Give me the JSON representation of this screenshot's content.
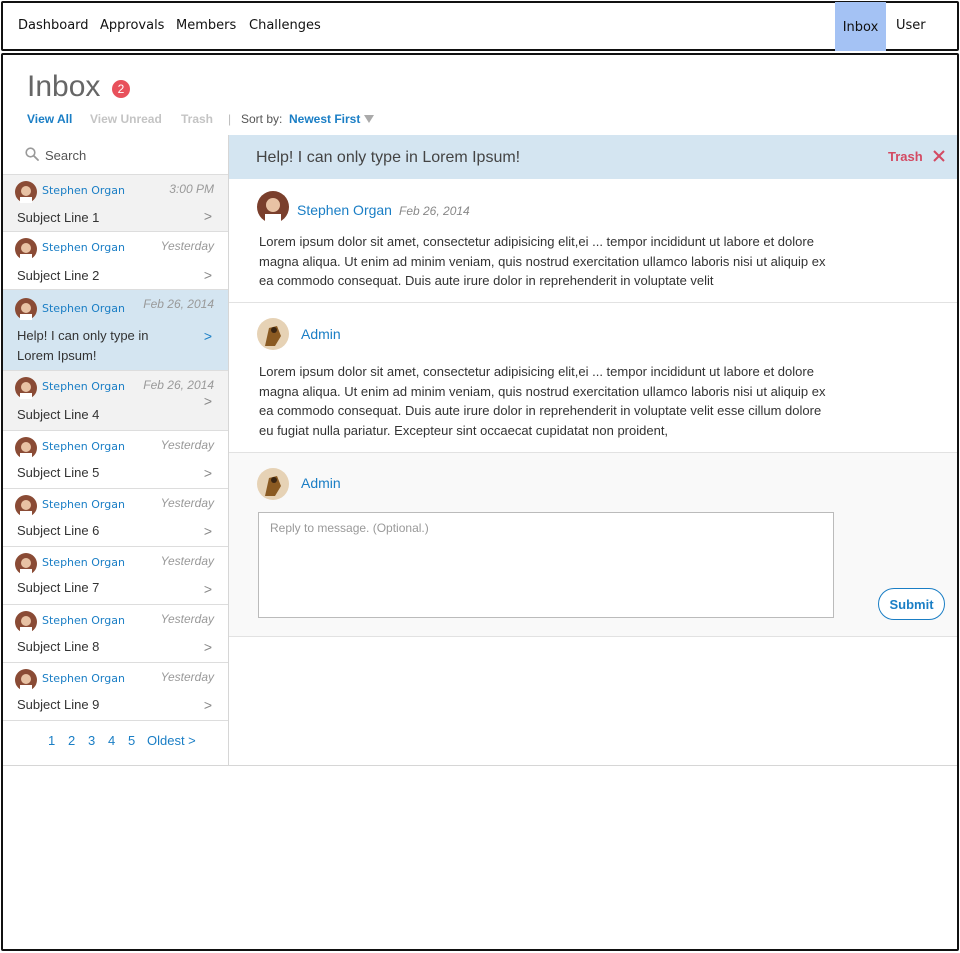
{
  "nav": {
    "items": [
      {
        "label": "Dashboard"
      },
      {
        "label": "Approvals"
      },
      {
        "label": "Members"
      },
      {
        "label": "Challenges"
      }
    ],
    "inbox": "Inbox",
    "user": "User",
    "active_color": "#a4c2f4"
  },
  "inbox": {
    "title": "Inbox",
    "unread_count": "2",
    "filters": {
      "view_all": "View All",
      "view_unread": "View Unread",
      "trash": "Trash",
      "divider": "|",
      "sort_label": "Sort by:",
      "sort_value": "Newest First"
    }
  },
  "search": {
    "placeholder": "Search"
  },
  "messages": [
    {
      "sender": "Stephen Organ",
      "time": "3:00 PM",
      "subject": "Subject Line 1",
      "chevron": ">"
    },
    {
      "sender": "Stephen Organ",
      "time": "Yesterday",
      "subject": "Subject Line 2",
      "chevron": ">"
    },
    {
      "sender": "Stephen Organ",
      "time": "Feb 26, 2014",
      "subject": "Help! I can only type in Lorem Ipsum!",
      "chevron": ">"
    },
    {
      "sender": "Stephen Organ",
      "time": "Feb 26, 2014",
      "subject": "Subject Line 4",
      "chevron": ">"
    },
    {
      "sender": "Stephen Organ",
      "time": "Yesterday",
      "subject": "Subject Line 5",
      "chevron": ">"
    },
    {
      "sender": "Stephen Organ",
      "time": "Yesterday",
      "subject": "Subject Line 6",
      "chevron": ">"
    },
    {
      "sender": "Stephen Organ",
      "time": "Yesterday",
      "subject": "Subject Line 7",
      "chevron": ">"
    },
    {
      "sender": "Stephen Organ",
      "time": "Yesterday",
      "subject": "Subject Line 8",
      "chevron": ">"
    },
    {
      "sender": "Stephen Organ",
      "time": "Yesterday",
      "subject": "Subject Line 9",
      "chevron": ">"
    }
  ],
  "pagination": {
    "pages": [
      "1",
      "2",
      "3",
      "4",
      "5"
    ],
    "oldest": "Oldest >"
  },
  "conversation": {
    "title": "Help! I can only type in Lorem Ipsum!",
    "trash": "Trash",
    "posts": [
      {
        "author": "Stephen Organ",
        "date": "Feb 26, 2014",
        "body": "Lorem ipsum dolor sit amet, consectetur adipisicing elit,ei ... tempor incididunt ut labore et dolore magna aliqua. Ut enim ad minim veniam, quis nostrud exercitation ullamco laboris nisi ut aliquip ex ea commodo consequat. Duis aute irure dolor in reprehenderit in voluptate velit"
      },
      {
        "author": "Admin",
        "body": "Lorem ipsum dolor sit amet, consectetur adipisicing elit,ei ... tempor incididunt ut labore et dolore magna aliqua. Ut enim ad minim veniam, quis nostrud exercitation ullamco laboris nisi ut aliquip ex ea commodo consequat. Duis aute irure dolor in reprehenderit in voluptate velit esse cillum dolore eu fugiat nulla pariatur. Excepteur sint occaecat cupidatat non proident,"
      }
    ],
    "reply": {
      "author": "Admin",
      "placeholder": "Reply to message. (Optional.)",
      "submit": "Submit"
    }
  },
  "colors": {
    "link": "#1a7ec5",
    "selected_row": "#d4e5f1",
    "badge": "#e8505b",
    "trash": "#d34a63"
  }
}
